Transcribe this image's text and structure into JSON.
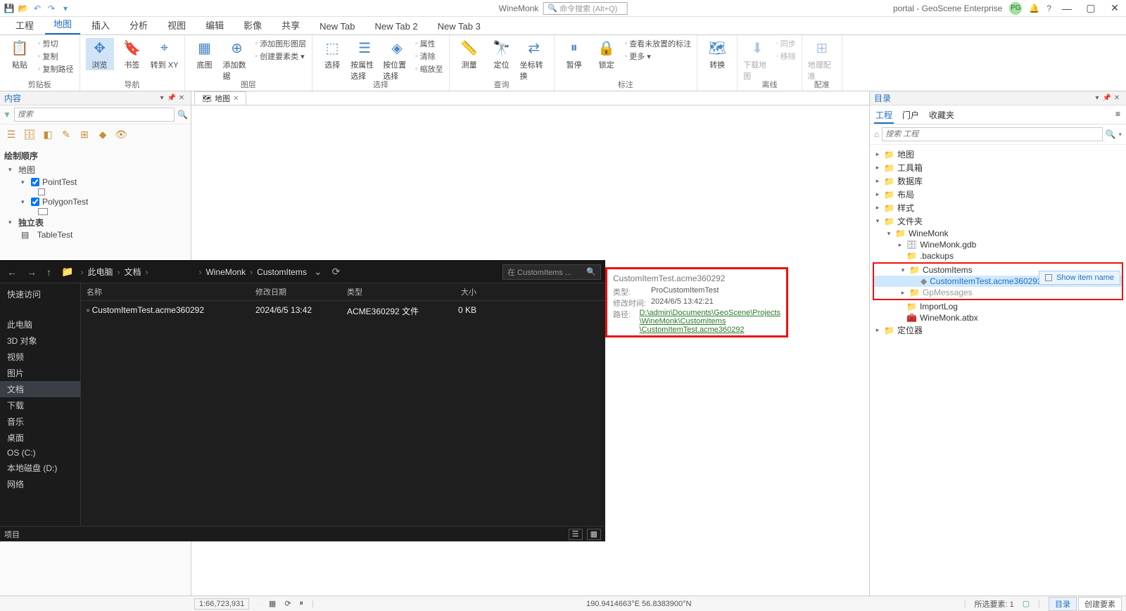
{
  "titlebar": {
    "app_title": "WineMonk",
    "searchbox_placeholder": "命令搜索 (Alt+Q)",
    "right_text": "portal - GeoScene Enterprise",
    "badge": "PG"
  },
  "ribbon_tabs": [
    "工程",
    "地图",
    "插入",
    "分析",
    "视图",
    "编辑",
    "影像",
    "共享",
    "New Tab",
    "New Tab 2",
    "New Tab 3"
  ],
  "ribbon_active_index": 1,
  "ribbon_groups": {
    "g1": {
      "label": "剪贴板",
      "big": "粘贴",
      "items": [
        "剪切",
        "复制",
        "复制路径"
      ]
    },
    "g2": {
      "label": "导航",
      "btns": [
        "浏览",
        "书签",
        "转到 XY"
      ]
    },
    "g3": {
      "label": "图层",
      "btns": [
        "底图",
        "添加数据"
      ],
      "items": [
        "添加图形图层",
        "创建要素类 ▾"
      ]
    },
    "g4": {
      "label": "选择",
      "btns": [
        "选择",
        "按属性选择",
        "按位置选择"
      ],
      "items": [
        "属性",
        "清除",
        "缩放至"
      ]
    },
    "g5": {
      "label": "查询",
      "btns": [
        "测量",
        "定位",
        "坐标转换"
      ]
    },
    "g6": {
      "label": "标注",
      "btns": [
        "暂停",
        "锁定"
      ],
      "items": [
        "查看未放置的标注",
        "更多 ▾"
      ]
    },
    "g7": {
      "label": "",
      "btns": [
        "转换"
      ]
    },
    "g8": {
      "label": "离线",
      "btns": [
        "下载地图"
      ],
      "items": [
        "同步",
        "移除"
      ]
    },
    "g9": {
      "label": "配准",
      "btns": [
        "地理配准"
      ]
    }
  },
  "contents_pane": {
    "title": "内容",
    "search_placeholder": "搜索",
    "section": "绘制顺序",
    "map_node": "地图",
    "layers": [
      "PointTest",
      "PolygonTest"
    ],
    "standalone_section": "独立表",
    "tables": [
      "TableTest"
    ]
  },
  "view_tab": "地图",
  "tooltip": {
    "title": "CustomItemTest.acme360292",
    "rows": [
      {
        "k": "类型:",
        "v": "ProCustomItemTest"
      },
      {
        "k": "修改时间:",
        "v": "2024/6/5 13:42:21"
      }
    ],
    "path_label": "路径:",
    "path_lines": [
      "D:\\admin\\Documents\\GeoScene\\Projects",
      "\\WineMonk\\CustomItems",
      "\\CustomItemTest.acme360292"
    ]
  },
  "explorer": {
    "breadcrumb": [
      "此电脑",
      "文档",
      "",
      "WineMonk",
      "CustomItems"
    ],
    "search_placeholder": "在 CustomItems ...",
    "columns": [
      "名称",
      "修改日期",
      "类型",
      "大小"
    ],
    "rows": [
      {
        "name": "CustomItemTest.acme360292",
        "date": "2024/6/5 13:42",
        "type": "ACME360292 文件",
        "size": "0 KB"
      }
    ],
    "sidebar_top": "快速访问",
    "sidebar": [
      "此电脑",
      "3D 对象",
      "视频",
      "图片",
      "文档",
      "下载",
      "音乐",
      "桌面",
      "OS (C:)",
      "本地磁盘 (D:)",
      "网络"
    ],
    "sidebar_selected": "文档",
    "footer_left": "项目"
  },
  "catalog": {
    "title": "目录",
    "tabs": [
      "工程",
      "门户",
      "收藏夹"
    ],
    "active_tab": 0,
    "search_placeholder": "搜索 工程",
    "tree": [
      {
        "lvl": 1,
        "tw": "▸",
        "ico": "folder",
        "label": "地图"
      },
      {
        "lvl": 1,
        "tw": "▸",
        "ico": "folder",
        "label": "工具箱"
      },
      {
        "lvl": 1,
        "tw": "▸",
        "ico": "folder",
        "label": "数据库"
      },
      {
        "lvl": 1,
        "tw": "▸",
        "ico": "folder",
        "label": "布局"
      },
      {
        "lvl": 1,
        "tw": "▸",
        "ico": "folder",
        "label": "样式"
      },
      {
        "lvl": 1,
        "tw": "▾",
        "ico": "folder",
        "label": "文件夹"
      },
      {
        "lvl": 2,
        "tw": "▾",
        "ico": "folder",
        "label": "WineMonk"
      },
      {
        "lvl": 3,
        "tw": "▸",
        "ico": "db",
        "label": "WineMonk.gdb"
      },
      {
        "lvl": 3,
        "tw": "",
        "ico": "folder",
        "label": ".backups"
      }
    ],
    "highlight_group": [
      {
        "lvl": 3,
        "tw": "▾",
        "ico": "folder",
        "label": "CustomItems"
      },
      {
        "lvl": 4,
        "tw": "",
        "ico": "item",
        "label": "CustomItemTest.acme360292",
        "selected": true
      },
      {
        "lvl": 3,
        "tw": "▸",
        "ico": "folder",
        "label": "GpMessages",
        "grey": true
      }
    ],
    "tree_tail": [
      {
        "lvl": 3,
        "tw": "",
        "ico": "folder",
        "label": "ImportLog"
      },
      {
        "lvl": 3,
        "tw": "",
        "ico": "tbx",
        "label": "WineMonk.atbx"
      },
      {
        "lvl": 1,
        "tw": "▸",
        "ico": "folder",
        "label": "定位器"
      }
    ],
    "ctx_menu": "Show item name"
  },
  "statusbar": {
    "scale": "1:66,723,931",
    "coord": "190.9414663°E 56.8383900°N",
    "sel": "所选要素: 1",
    "tabs": [
      "目录",
      "创建要素"
    ]
  }
}
